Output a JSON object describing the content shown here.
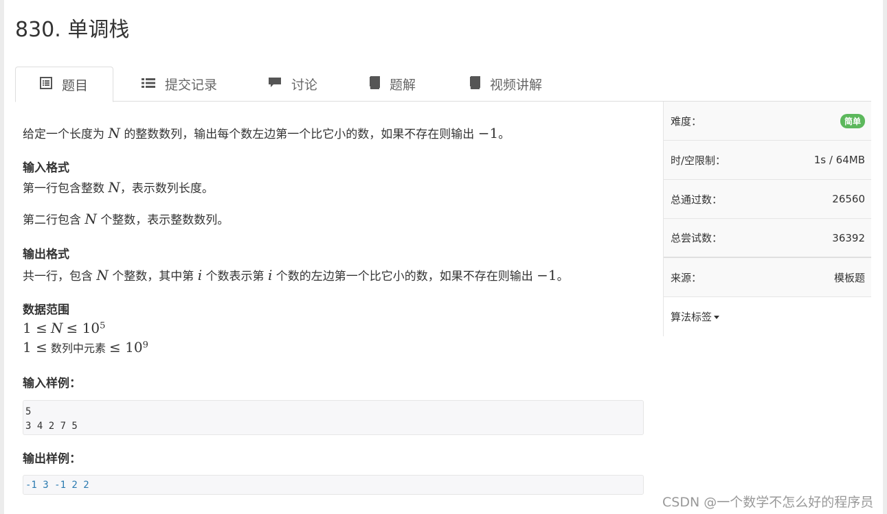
{
  "problem": {
    "title": "830. 单调栈"
  },
  "tabs": [
    {
      "label": "题目",
      "icon": "list-alt-icon"
    },
    {
      "label": "提交记录",
      "icon": "list-icon"
    },
    {
      "label": "讨论",
      "icon": "comment-icon"
    },
    {
      "label": "题解",
      "icon": "book-icon"
    },
    {
      "label": "视频讲解",
      "icon": "book-icon"
    }
  ],
  "description": {
    "intro_pre": "给定一个长度为",
    "intro_n": "N",
    "intro_mid": "的整数数列，输出每个数左边第一个比它小的数，如果不存在则输出",
    "intro_val": "−1",
    "intro_end": "。",
    "input_heading": "输入格式",
    "input_line1_pre": "第一行包含整数",
    "input_line1_n": "N",
    "input_line1_post": "，表示数列长度。",
    "input_line2_pre": "第二行包含",
    "input_line2_n": "N",
    "input_line2_post": "个整数，表示整数数列。",
    "output_heading": "输出格式",
    "output_pre": "共一行，包含",
    "output_n": "N",
    "output_mid1": "个整数，其中第",
    "output_i1": "i",
    "output_mid2": "个数表示第",
    "output_i2": "i",
    "output_mid3": "个数的左边第一个比它小的数，如果不存在则输出",
    "output_val": "−1",
    "output_end": "。",
    "range_heading": "数据范围",
    "range1_left": "1 ≤",
    "range1_n": "N",
    "range1_right": "≤ 10",
    "range1_exp": "5",
    "range2_left": "1 ≤",
    "range2_text": "数列中元素",
    "range2_right": "≤ 10",
    "range2_exp": "9",
    "sample_in_heading": "输入样例：",
    "sample_in": "5\n3 4 2 7 5",
    "sample_out_heading": "输出样例：",
    "sample_out": "-1 3 -1 2 2"
  },
  "sidebar": {
    "difficulty_label": "难度：",
    "difficulty_value": "简单",
    "limit_label": "时/空限制：",
    "limit_value": "1s / 64MB",
    "passed_label": "总通过数：",
    "passed_value": "26560",
    "tried_label": "总尝试数：",
    "tried_value": "36392",
    "source_label": "来源：",
    "source_value": "模板题",
    "tags_label": "算法标签"
  },
  "colors": {
    "badge_green": "#5cb85c",
    "output_blue": "#2a7ab0"
  },
  "watermark": "CSDN @一个数学不怎么好的程序员"
}
